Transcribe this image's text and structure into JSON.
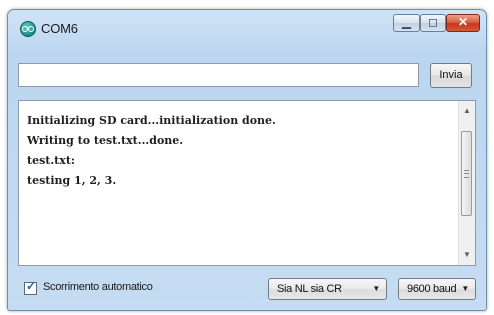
{
  "window": {
    "title": "COM6",
    "controls": {
      "minimize": "▁",
      "maximize": "◻",
      "close": "✕"
    }
  },
  "send": {
    "input_value": "",
    "button_label": "Invia"
  },
  "monitor": {
    "lines": [
      "Initializing SD card...initialization done.",
      "Writing to test.txt...done.",
      "test.txt:",
      "testing 1, 2, 3."
    ]
  },
  "footer": {
    "autoscroll_label": "Scorrimento automatico",
    "autoscroll_checked": true,
    "line_ending": "Sia NL sia CR",
    "baud_rate": "9600 baud"
  },
  "icons": {
    "app": "arduino-icon",
    "dropdown": "chevron-down-icon"
  }
}
